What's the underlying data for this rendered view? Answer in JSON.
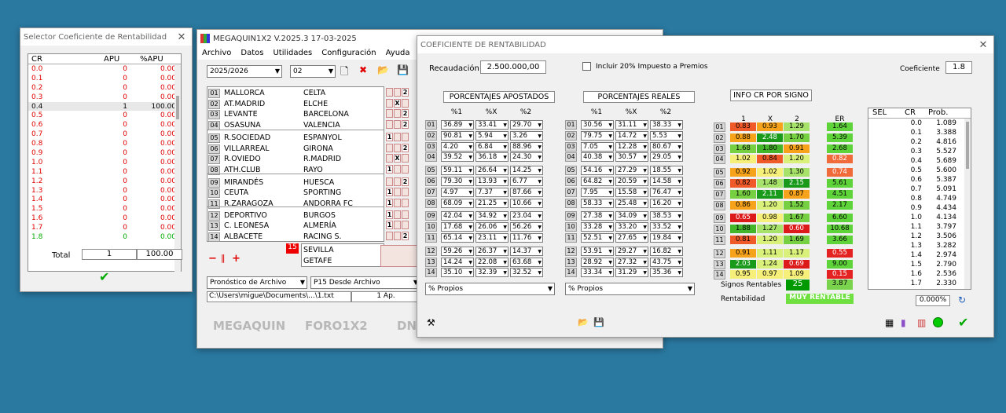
{
  "selector": {
    "title": "Selector Coeficiente de Rentabilidad",
    "headers": [
      "CR",
      "APU",
      "%APU"
    ],
    "rows": [
      [
        "0.0",
        "0",
        "0.00"
      ],
      [
        "0.1",
        "0",
        "0.00"
      ],
      [
        "0.2",
        "0",
        "0.00"
      ],
      [
        "0.3",
        "0",
        "0.00"
      ],
      [
        "0.4",
        "1",
        "100.00"
      ],
      [
        "0.5",
        "0",
        "0.00"
      ],
      [
        "0.6",
        "0",
        "0.00"
      ],
      [
        "0.7",
        "0",
        "0.00"
      ],
      [
        "0.8",
        "0",
        "0.00"
      ],
      [
        "0.9",
        "0",
        "0.00"
      ],
      [
        "1.0",
        "0",
        "0.00"
      ],
      [
        "1.1",
        "0",
        "0.00"
      ],
      [
        "1.2",
        "0",
        "0.00"
      ],
      [
        "1.3",
        "0",
        "0.00"
      ],
      [
        "1.4",
        "0",
        "0.00"
      ],
      [
        "1.5",
        "0",
        "0.00"
      ],
      [
        "1.6",
        "0",
        "0.00"
      ],
      [
        "1.7",
        "0",
        "0.00"
      ],
      [
        "1.8",
        "0",
        "0.00"
      ]
    ],
    "total_label": "Total",
    "total_apu": "1",
    "total_pct": "100.00"
  },
  "main": {
    "title": "MEGAQUIN1X2  V.2025.3 17-03-2025",
    "menu": [
      "Archivo",
      "Datos",
      "Utilidades",
      "Configuración",
      "Ayuda"
    ],
    "season": "2025/2026",
    "jornada": "02",
    "matches": [
      [
        "01",
        "MALLORCA",
        "CELTA"
      ],
      [
        "02",
        "AT.MADRID",
        "ELCHE"
      ],
      [
        "03",
        "LEVANTE",
        "BARCELONA"
      ],
      [
        "04",
        "OSASUNA",
        "VALENCIA"
      ],
      [
        "05",
        "R.SOCIEDAD",
        "ESPANYOL"
      ],
      [
        "06",
        "VILLARREAL",
        "GIRONA"
      ],
      [
        "07",
        "R.OVIEDO",
        "R.MADRID"
      ],
      [
        "08",
        "ATH.CLUB",
        "RAYO"
      ],
      [
        "09",
        "MIRANDÉS",
        "HUESCA"
      ],
      [
        "10",
        "CEUTA",
        "SPORTING"
      ],
      [
        "11",
        "R.ZARAGOZA",
        "ANDORRA FC"
      ],
      [
        "12",
        "DEPORTIVO",
        "BURGOS"
      ],
      [
        "13",
        "C. LEONESA",
        "ALMERÍA"
      ],
      [
        "14",
        "ALBACETE",
        "RACING S."
      ]
    ],
    "picks": [
      "2",
      "X",
      "2",
      "2",
      "1",
      "2",
      "X",
      "1",
      "2",
      "1",
      "1",
      "1",
      "1",
      "2"
    ],
    "pleno_num": "15",
    "pleno_home": "SEVILLA",
    "pleno_away": "GETAFE",
    "sel1": "Pronóstico de Archivo",
    "sel2": "P15 Desde Archivo",
    "path": "C:\\Users\\migue\\Documents\\...\\1.txt",
    "apuestas": "1 Ap.",
    "brands": [
      "MEGAQUIN",
      "FORO1X2",
      "DN"
    ]
  },
  "coef": {
    "title": "COEFICIENTE DE RENTABILIDAD",
    "recaudacion_label": "Recaudación",
    "recaudacion": "2.500.000,00",
    "incluir_label": "Incluir 20% Impuesto a Premios",
    "coef_label": "Coeficiente",
    "coef_value": "1.8",
    "apostados_title": "PORCENTAJES APOSTADOS",
    "reales_title": "PORCENTAJES REALES",
    "info_title": "INFO CR POR SIGNO",
    "pct_headers": [
      "%1",
      "%X",
      "%2"
    ],
    "sign_headers": [
      "1",
      "X",
      "2"
    ],
    "er_header": "ER",
    "apostados": [
      [
        "36.89",
        "33.41",
        "29.70"
      ],
      [
        "90.81",
        "5.94",
        "3.26"
      ],
      [
        "4.20",
        "6.84",
        "88.96"
      ],
      [
        "39.52",
        "36.18",
        "24.30"
      ],
      [
        "59.11",
        "26.64",
        "14.25"
      ],
      [
        "79.30",
        "13.93",
        "6.77"
      ],
      [
        "4.97",
        "7.37",
        "87.66"
      ],
      [
        "68.09",
        "21.25",
        "10.66"
      ],
      [
        "42.04",
        "34.92",
        "23.04"
      ],
      [
        "17.68",
        "26.06",
        "56.26"
      ],
      [
        "65.14",
        "23.11",
        "11.76"
      ],
      [
        "59.26",
        "26.37",
        "14.37"
      ],
      [
        "14.24",
        "22.08",
        "63.68"
      ],
      [
        "35.10",
        "32.39",
        "32.52"
      ]
    ],
    "reales": [
      [
        "30.56",
        "31.11",
        "38.33"
      ],
      [
        "79.75",
        "14.72",
        "5.53"
      ],
      [
        "7.05",
        "12.28",
        "80.67"
      ],
      [
        "40.38",
        "30.57",
        "29.05"
      ],
      [
        "54.16",
        "27.29",
        "18.55"
      ],
      [
        "64.82",
        "20.59",
        "14.58"
      ],
      [
        "7.95",
        "15.58",
        "76.47"
      ],
      [
        "58.33",
        "25.48",
        "16.20"
      ],
      [
        "27.38",
        "34.09",
        "38.53"
      ],
      [
        "33.28",
        "33.20",
        "33.52"
      ],
      [
        "52.51",
        "27.65",
        "19.84"
      ],
      [
        "53.91",
        "29.27",
        "16.82"
      ],
      [
        "28.92",
        "27.32",
        "43.75"
      ],
      [
        "33.34",
        "31.29",
        "35.36"
      ]
    ],
    "cr": [
      [
        "0.83",
        "0.93",
        "1.29"
      ],
      [
        "0.88",
        "2.48",
        "1.70"
      ],
      [
        "1.68",
        "1.80",
        "0.91"
      ],
      [
        "1.02",
        "0.84",
        "1.20"
      ],
      [
        "0.92",
        "1.02",
        "1.30"
      ],
      [
        "0.82",
        "1.48",
        "2.15"
      ],
      [
        "1.60",
        "2.11",
        "0.87"
      ],
      [
        "0.86",
        "1.20",
        "1.52"
      ],
      [
        "0.65",
        "0.98",
        "1.67"
      ],
      [
        "1.88",
        "1.27",
        "0.60"
      ],
      [
        "0.81",
        "1.20",
        "1.69"
      ],
      [
        "0.91",
        "1.11",
        "1.17"
      ],
      [
        "2.03",
        "1.24",
        "0.69"
      ],
      [
        "0.95",
        "0.97",
        "1.09"
      ]
    ],
    "er": [
      "1.64",
      "5.39",
      "2.68",
      "0.82",
      "0.74",
      "5.61",
      "4.51",
      "2.17",
      "6.60",
      "10.68",
      "3.66",
      "0.55",
      "9.00",
      "0.15"
    ],
    "signos_label": "Signos Rentables",
    "signos_value": "25",
    "signos_er": "3.87",
    "rent_label": "Rentabilidad",
    "rent_value": "MUY RENTABLE",
    "propios": "% Propios",
    "sel_headers": [
      "SEL",
      "CR",
      "Prob."
    ],
    "prob": [
      [
        "0.0",
        "1.089"
      ],
      [
        "0.1",
        "3.388"
      ],
      [
        "0.2",
        "4.816"
      ],
      [
        "0.3",
        "5.527"
      ],
      [
        "0.4",
        "5.689"
      ],
      [
        "0.5",
        "5.600"
      ],
      [
        "0.6",
        "5.387"
      ],
      [
        "0.7",
        "5.091"
      ],
      [
        "0.8",
        "4.749"
      ],
      [
        "0.9",
        "4.434"
      ],
      [
        "1.0",
        "4.134"
      ],
      [
        "1.1",
        "3.797"
      ],
      [
        "1.2",
        "3.506"
      ],
      [
        "1.3",
        "3.282"
      ],
      [
        "1.4",
        "2.974"
      ],
      [
        "1.5",
        "2.790"
      ],
      [
        "1.6",
        "2.536"
      ],
      [
        "1.7",
        "2.330"
      ]
    ],
    "pct_total": "0.000%"
  }
}
